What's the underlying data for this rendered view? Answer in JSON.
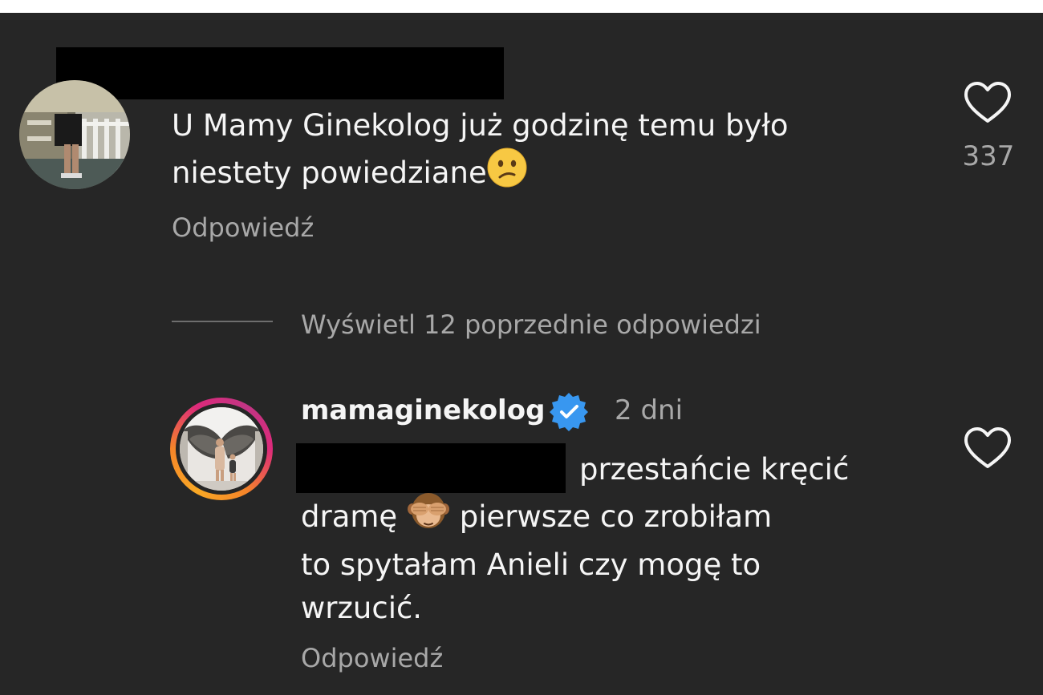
{
  "comment1": {
    "text_line1": "U Mamy Ginekolog już godzinę temu było",
    "text_line2": "niestety powiedziane",
    "reply_label": "Odpowiedź",
    "like_count": "337"
  },
  "thread": {
    "view_replies_label": "Wyświetl 12 poprzednie odpowiedzi"
  },
  "reply1": {
    "username": "mamaginekolog",
    "time": "2 dni",
    "text_line1": "przestańcie kręcić",
    "text_line2a": "dramę",
    "text_line2b": "pierwsze co zrobiłam",
    "text_line3": "to spytałam Anieli czy mogę to",
    "text_line4": "wrzucić.",
    "reply_label": "Odpowiedź"
  },
  "icons": {
    "like": "heart-outline-icon",
    "verified": "verified-badge-icon",
    "emoji1": "confused-face-emoji",
    "emoji2": "see-no-evil-monkey-emoji"
  },
  "colors": {
    "background": "#262626",
    "text_primary": "#f5f5f5",
    "text_secondary": "#a8a8a8",
    "verified_blue": "#3897f0"
  }
}
